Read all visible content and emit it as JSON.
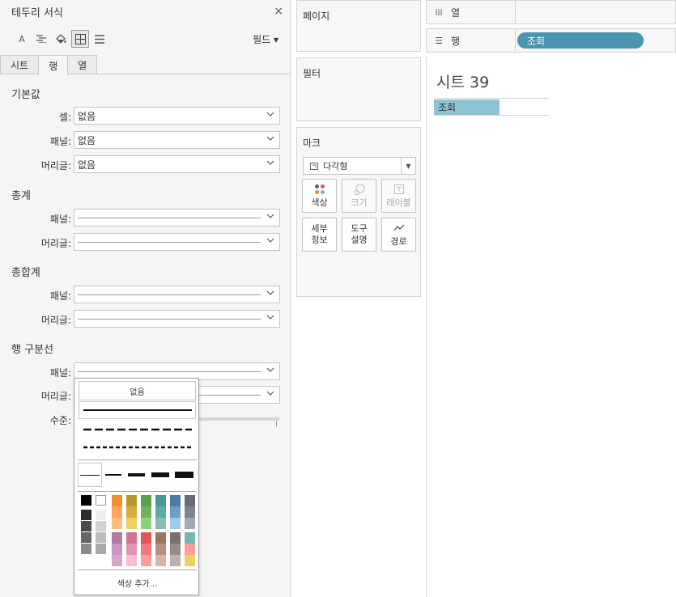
{
  "format_pane": {
    "title": "테두리 서식",
    "close": "×",
    "toolbar": {
      "font_label": "A",
      "fields_label": "필드 ▾"
    },
    "tabs": [
      {
        "label": "시트"
      },
      {
        "label": "행"
      },
      {
        "label": "열"
      }
    ],
    "sections": {
      "default": {
        "title": "기본값",
        "rows": [
          {
            "label": "셀:",
            "value": "없음"
          },
          {
            "label": "패널:",
            "value": "없음"
          },
          {
            "label": "머리글:",
            "value": "없음"
          }
        ]
      },
      "totals": {
        "title": "총계",
        "rows": [
          {
            "label": "패널:"
          },
          {
            "label": "머리글:"
          }
        ]
      },
      "grand_totals": {
        "title": "총합계",
        "rows": [
          {
            "label": "패널:"
          },
          {
            "label": "머리글:"
          }
        ]
      },
      "row_divider": {
        "title": "행 구분선",
        "rows": [
          {
            "label": "패널:"
          },
          {
            "label": "머리글:"
          },
          {
            "label": "수준:"
          }
        ]
      }
    }
  },
  "line_popup": {
    "none_label": "없음",
    "more_colors": "색상 추가...",
    "colors": {
      "grays": [
        "#000000",
        "#2b2b2b",
        "#4a4a4a",
        "#666666",
        "#8a8a8a"
      ],
      "whites": [
        "#ffffff",
        "#eeeeee",
        "#d2d2d2",
        "#bcbcbc",
        "#a8a8a8"
      ],
      "top_columns": [
        [
          "#f28e2b",
          "#ffa85a",
          "#ffbe7d"
        ],
        [
          "#b6992d",
          "#d4ae3a",
          "#f1ce63"
        ],
        [
          "#59a14f",
          "#74b35e",
          "#8cd17d"
        ],
        [
          "#499894",
          "#5eaca8",
          "#86bcb6"
        ],
        [
          "#4e79a7",
          "#709cc7",
          "#a0cbe8"
        ],
        [
          "#666b77",
          "#7e8591",
          "#a3a9b3"
        ]
      ],
      "bottom_columns": [
        [
          "#b07aa1",
          "#c896be",
          "#d4a6c8"
        ],
        [
          "#d37295",
          "#e693b2",
          "#fabfd2"
        ],
        [
          "#e15759",
          "#f07a7a",
          "#ff9d9a"
        ],
        [
          "#9d7660",
          "#b7937e",
          "#d7b5a6"
        ],
        [
          "#79706e",
          "#958c88",
          "#bab0ac"
        ],
        [
          "#76b7b2",
          "#ff9d9a",
          "#f1ce63"
        ]
      ]
    }
  },
  "pages_card": {
    "title": "페이지"
  },
  "filters_card": {
    "title": "필터"
  },
  "marks_card": {
    "title": "마크",
    "type": "다각형",
    "buttons": [
      {
        "label": "색상",
        "enabled": true
      },
      {
        "label": "크기",
        "enabled": false
      },
      {
        "label": "레이블",
        "enabled": false
      },
      {
        "label": "세부\n정보",
        "l1": "세부",
        "l2": "정보",
        "enabled": true
      },
      {
        "label": "도구\n설명",
        "l1": "도구",
        "l2": "설명",
        "enabled": true
      },
      {
        "label": "경로",
        "enabled": true
      }
    ]
  },
  "shelves": {
    "columns": {
      "icon": "iii",
      "label": "열"
    },
    "rows": {
      "icon": "☰",
      "label": "행",
      "pill": "조회"
    }
  },
  "sheet": {
    "title": "시트 39",
    "bar_label": "조회",
    "bar_fraction": 0.57
  }
}
